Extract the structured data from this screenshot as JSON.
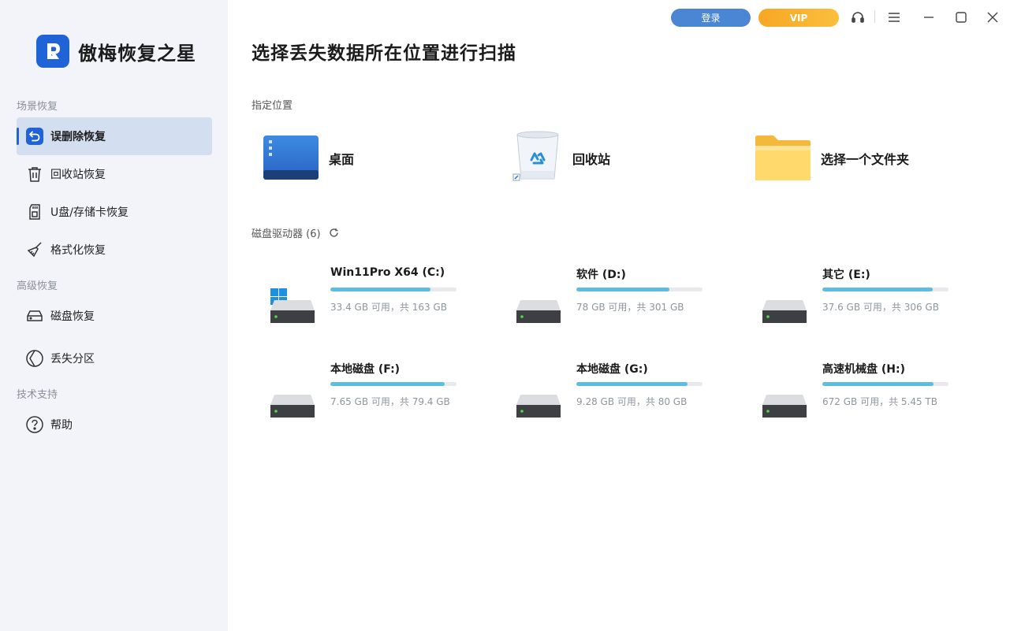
{
  "app": {
    "name": "傲梅恢复之星",
    "title": "选择丢失数据所在位置进行扫描"
  },
  "topbar": {
    "login_label": "登录",
    "vip_label": "VIP",
    "icons": [
      "headset-icon",
      "menu-icon",
      "minimize-icon",
      "maximize-icon",
      "close-icon"
    ]
  },
  "sidebar": {
    "sections": [
      {
        "label": "场景恢复"
      },
      {
        "label": "高级恢复"
      },
      {
        "label": "技术支持"
      }
    ],
    "items": [
      {
        "label": "误删除恢复",
        "icon": "undo-icon",
        "active": true
      },
      {
        "label": "回收站恢复",
        "icon": "trash-icon"
      },
      {
        "label": "U盘/存储卡恢复",
        "icon": "sd-card-icon"
      },
      {
        "label": "格式化恢复",
        "icon": "broom-icon"
      },
      {
        "label": "磁盘恢复",
        "icon": "disk-icon"
      },
      {
        "label": "丢失分区",
        "icon": "partition-icon"
      },
      {
        "label": "帮助",
        "icon": "help-icon"
      }
    ]
  },
  "locations": {
    "heading": "指定位置",
    "items": [
      {
        "label": "桌面",
        "icon": "desktop-icon"
      },
      {
        "label": "回收站",
        "icon": "recycle-bin-icon"
      },
      {
        "label": "选择一个文件夹",
        "icon": "folder-icon"
      }
    ]
  },
  "drives": {
    "heading": "磁盘驱动器 (6)",
    "items": [
      {
        "name": "Win11Pro X64 (C:)",
        "info": "33.4 GB 可用，共 163 GB",
        "used_fraction": 0.795,
        "system": true
      },
      {
        "name": "软件 (D:)",
        "info": "78 GB 可用，共 301 GB",
        "used_fraction": 0.74
      },
      {
        "name": "其它 (E:)",
        "info": "37.6 GB 可用，共 306 GB",
        "used_fraction": 0.877
      },
      {
        "name": "本地磁盘 (F:)",
        "info": "7.65 GB 可用，共 79.4 GB",
        "used_fraction": 0.904
      },
      {
        "name": "本地磁盘 (G:)",
        "info": "9.28 GB 可用，共 80 GB",
        "used_fraction": 0.884
      },
      {
        "name": "高速机械盘 (H:)",
        "info": "672 GB 可用，共 5.45 TB",
        "used_fraction": 0.88
      }
    ]
  },
  "colors": {
    "accent": "#1f63d6",
    "drive_bar": "#5bbde5",
    "vip": "#f7a623"
  }
}
